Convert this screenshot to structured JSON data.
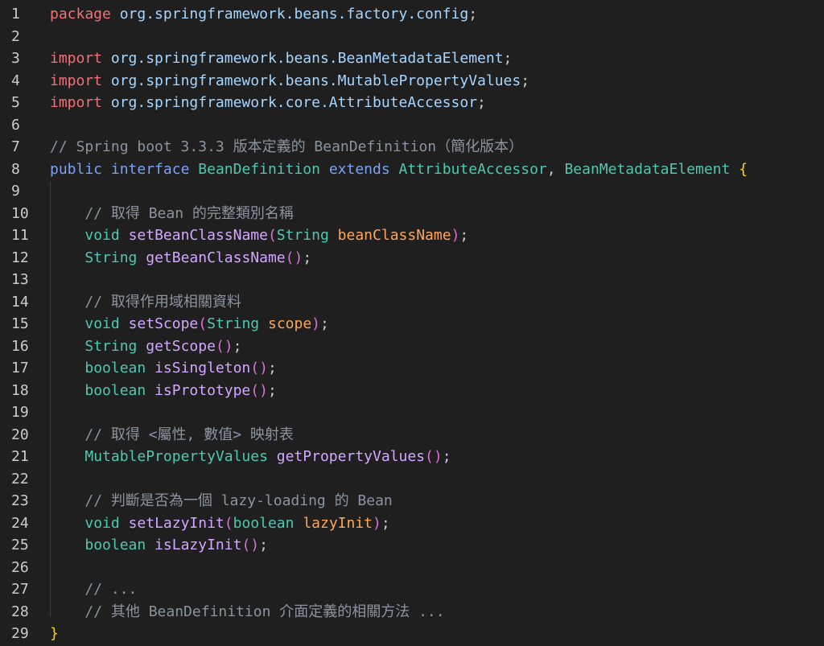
{
  "colors": {
    "background": "#1f1f1f",
    "line_number": "#cccccc",
    "keyword_import": "#f07178",
    "keyword_declaration": "#7aa2f7",
    "type": "#4ec9b0",
    "function": "#d2a8ff",
    "parameter": "#ffa657",
    "comment": "#8b949e",
    "brace": "#ffd700"
  },
  "lines": [
    {
      "n": "1",
      "tokens": [
        [
          "kw-ctrl",
          "package"
        ],
        [
          "punc",
          " "
        ],
        [
          "pkg",
          "org.springframework.beans.factory.config"
        ],
        [
          "punc",
          ";"
        ]
      ]
    },
    {
      "n": "2",
      "tokens": []
    },
    {
      "n": "3",
      "tokens": [
        [
          "kw-ctrl",
          "import"
        ],
        [
          "punc",
          " "
        ],
        [
          "pkg",
          "org.springframework.beans.BeanMetadataElement"
        ],
        [
          "punc",
          ";"
        ]
      ]
    },
    {
      "n": "4",
      "tokens": [
        [
          "kw-ctrl",
          "import"
        ],
        [
          "punc",
          " "
        ],
        [
          "pkg",
          "org.springframework.beans.MutablePropertyValues"
        ],
        [
          "punc",
          ";"
        ]
      ]
    },
    {
      "n": "5",
      "tokens": [
        [
          "kw-ctrl",
          "import"
        ],
        [
          "punc",
          " "
        ],
        [
          "pkg",
          "org.springframework.core.AttributeAccessor"
        ],
        [
          "punc",
          ";"
        ]
      ]
    },
    {
      "n": "6",
      "tokens": []
    },
    {
      "n": "7",
      "tokens": [
        [
          "cmt",
          "// Spring boot 3.3.3 版本定義的 BeanDefinition（簡化版本）"
        ]
      ]
    },
    {
      "n": "8",
      "tokens": [
        [
          "kw-decl",
          "public"
        ],
        [
          "punc",
          " "
        ],
        [
          "kw-decl",
          "interface"
        ],
        [
          "punc",
          " "
        ],
        [
          "type",
          "BeanDefinition"
        ],
        [
          "punc",
          " "
        ],
        [
          "kw-decl",
          "extends"
        ],
        [
          "punc",
          " "
        ],
        [
          "type",
          "AttributeAccessor"
        ],
        [
          "punc",
          ", "
        ],
        [
          "type",
          "BeanMetadataElement"
        ],
        [
          "punc",
          " "
        ],
        [
          "brace",
          "{"
        ]
      ]
    },
    {
      "n": "9",
      "tokens": []
    },
    {
      "n": "10",
      "tokens": [
        [
          "punc",
          "    "
        ],
        [
          "cmt",
          "// 取得 Bean 的完整類別名稱"
        ]
      ]
    },
    {
      "n": "11",
      "tokens": [
        [
          "punc",
          "    "
        ],
        [
          "type",
          "void"
        ],
        [
          "punc",
          " "
        ],
        [
          "fn",
          "setBeanClassName"
        ],
        [
          "paren",
          "("
        ],
        [
          "type",
          "String"
        ],
        [
          "punc",
          " "
        ],
        [
          "param",
          "beanClassName"
        ],
        [
          "paren",
          ")"
        ],
        [
          "punc",
          ";"
        ]
      ]
    },
    {
      "n": "12",
      "tokens": [
        [
          "punc",
          "    "
        ],
        [
          "type",
          "String"
        ],
        [
          "punc",
          " "
        ],
        [
          "fn",
          "getBeanClassName"
        ],
        [
          "paren",
          "()"
        ],
        [
          "punc",
          ";"
        ]
      ]
    },
    {
      "n": "13",
      "tokens": []
    },
    {
      "n": "14",
      "tokens": [
        [
          "punc",
          "    "
        ],
        [
          "cmt",
          "// 取得作用域相關資料"
        ]
      ]
    },
    {
      "n": "15",
      "tokens": [
        [
          "punc",
          "    "
        ],
        [
          "type",
          "void"
        ],
        [
          "punc",
          " "
        ],
        [
          "fn",
          "setScope"
        ],
        [
          "paren",
          "("
        ],
        [
          "type",
          "String"
        ],
        [
          "punc",
          " "
        ],
        [
          "param",
          "scope"
        ],
        [
          "paren",
          ")"
        ],
        [
          "punc",
          ";"
        ]
      ]
    },
    {
      "n": "16",
      "tokens": [
        [
          "punc",
          "    "
        ],
        [
          "type",
          "String"
        ],
        [
          "punc",
          " "
        ],
        [
          "fn",
          "getScope"
        ],
        [
          "paren",
          "()"
        ],
        [
          "punc",
          ";"
        ]
      ]
    },
    {
      "n": "17",
      "tokens": [
        [
          "punc",
          "    "
        ],
        [
          "type",
          "boolean"
        ],
        [
          "punc",
          " "
        ],
        [
          "fn",
          "isSingleton"
        ],
        [
          "paren",
          "()"
        ],
        [
          "punc",
          ";"
        ]
      ]
    },
    {
      "n": "18",
      "tokens": [
        [
          "punc",
          "    "
        ],
        [
          "type",
          "boolean"
        ],
        [
          "punc",
          " "
        ],
        [
          "fn",
          "isPrototype"
        ],
        [
          "paren",
          "()"
        ],
        [
          "punc",
          ";"
        ]
      ]
    },
    {
      "n": "19",
      "tokens": []
    },
    {
      "n": "20",
      "tokens": [
        [
          "punc",
          "    "
        ],
        [
          "cmt",
          "// 取得 <屬性, 數值> 映射表"
        ]
      ]
    },
    {
      "n": "21",
      "tokens": [
        [
          "punc",
          "    "
        ],
        [
          "type",
          "MutablePropertyValues"
        ],
        [
          "punc",
          " "
        ],
        [
          "fn",
          "getPropertyValues"
        ],
        [
          "paren",
          "()"
        ],
        [
          "punc",
          ";"
        ]
      ]
    },
    {
      "n": "22",
      "tokens": []
    },
    {
      "n": "23",
      "tokens": [
        [
          "punc",
          "    "
        ],
        [
          "cmt",
          "// 判斷是否為一個 lazy-loading 的 Bean"
        ]
      ]
    },
    {
      "n": "24",
      "tokens": [
        [
          "punc",
          "    "
        ],
        [
          "type",
          "void"
        ],
        [
          "punc",
          " "
        ],
        [
          "fn",
          "setLazyInit"
        ],
        [
          "paren",
          "("
        ],
        [
          "type",
          "boolean"
        ],
        [
          "punc",
          " "
        ],
        [
          "param",
          "lazyInit"
        ],
        [
          "paren",
          ")"
        ],
        [
          "punc",
          ";"
        ]
      ]
    },
    {
      "n": "25",
      "tokens": [
        [
          "punc",
          "    "
        ],
        [
          "type",
          "boolean"
        ],
        [
          "punc",
          " "
        ],
        [
          "fn",
          "isLazyInit"
        ],
        [
          "paren",
          "()"
        ],
        [
          "punc",
          ";"
        ]
      ]
    },
    {
      "n": "26",
      "tokens": []
    },
    {
      "n": "27",
      "tokens": [
        [
          "punc",
          "    "
        ],
        [
          "cmt",
          "// ..."
        ]
      ]
    },
    {
      "n": "28",
      "tokens": [
        [
          "punc",
          "    "
        ],
        [
          "cmt",
          "// 其他 BeanDefinition 介面定義的相關方法 ..."
        ]
      ]
    },
    {
      "n": "29",
      "tokens": [
        [
          "brace",
          "}"
        ]
      ]
    }
  ]
}
